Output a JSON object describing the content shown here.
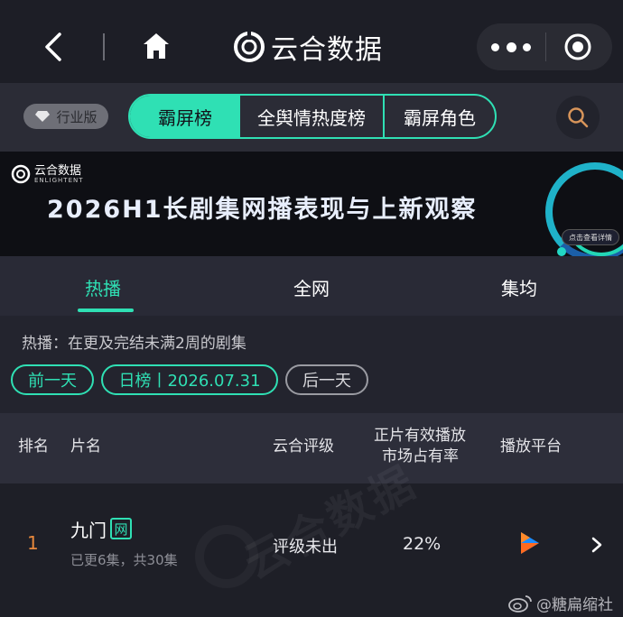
{
  "nav": {
    "title": "云合数据"
  },
  "segment": {
    "edition_label": "行业版",
    "tabs": [
      "霸屏榜",
      "全舆情热度榜",
      "霸屏角色"
    ],
    "active_index": 0
  },
  "banner": {
    "logo_text": "云合数据",
    "logo_sub": "ENLIGHTENT",
    "title": "2026H1长剧集网播表现与上新观察",
    "cta": "点击查看详情"
  },
  "tabs": {
    "items": [
      "热播",
      "全网",
      "集均"
    ],
    "active_index": 0
  },
  "info": {
    "description": "热播：在更及完结未满2周的剧集",
    "prev_label": "前一天",
    "date_label": "日榜丨2026.07.31",
    "next_label": "后一天"
  },
  "table": {
    "headers": {
      "rank": "排名",
      "name": "片名",
      "grade": "云合评级",
      "share_line1": "正片有效播放",
      "share_line2": "市场占有率",
      "platform": "播放平台"
    },
    "rows": [
      {
        "rank": "1",
        "name": "九门",
        "badge": "网",
        "sub": "已更6集，共30集",
        "grade": "评级未出",
        "share": "22%",
        "platform_icon": "youku-icon"
      }
    ]
  },
  "watermark": {
    "text": "云合数据",
    "weibo": "@糖扁缩社"
  },
  "colors": {
    "accent": "#2fe0b4",
    "rank": "#e8883c",
    "background": "#1b1c24"
  }
}
